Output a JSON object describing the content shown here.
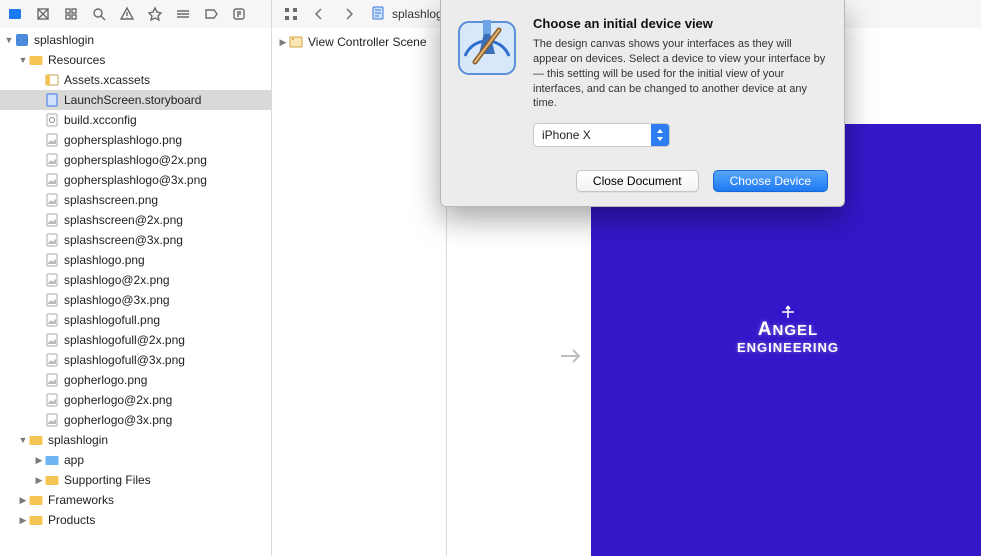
{
  "toolbar": {
    "file_tab_label": "splashlogin"
  },
  "navigator": {
    "root": "splashlogin",
    "resources_group": "Resources",
    "frameworks_group": "Frameworks",
    "products_group": "Products",
    "splashlogin_group": "splashlogin",
    "app_group": "app",
    "supporting_group": "Supporting Files",
    "items": [
      "Assets.xcassets",
      "LaunchScreen.storyboard",
      "build.xcconfig",
      "gophersplashlogo.png",
      "gophersplashlogo@2x.png",
      "gophersplashlogo@3x.png",
      "splashscreen.png",
      "splashscreen@2x.png",
      "splashscreen@3x.png",
      "splashlogo.png",
      "splashlogo@2x.png",
      "splashlogo@3x.png",
      "splashlogofull.png",
      "splashlogofull@2x.png",
      "splashlogofull@3x.png",
      "gopherlogo.png",
      "gopherlogo@2x.png",
      "gopherlogo@3x.png"
    ]
  },
  "outline": {
    "scene": "View Controller Scene"
  },
  "modal": {
    "title": "Choose an initial device view",
    "body": "The design canvas shows your interfaces as they will appear on devices. Select a device to view your interface by — this setting will be used for the initial view of your interfaces, and can be changed to another device at any time.",
    "selected_device": "iPhone X",
    "close_label": "Close Document",
    "choose_label": "Choose Device"
  },
  "device_preview": {
    "logo_line1_prefix": "A",
    "logo_line1_rest": "NGEL",
    "logo_line2": "ENGINEERING",
    "bg_color": "#3417c9"
  }
}
